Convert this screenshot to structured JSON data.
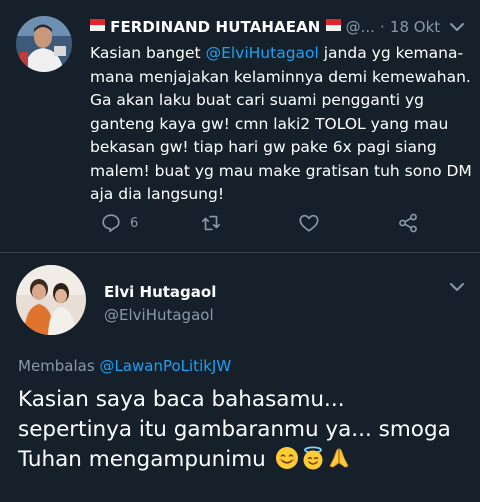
{
  "tweet": {
    "author_name": "FERDINAND HUTAHAEAN",
    "handle_truncated": "@...",
    "dot": "·",
    "time": "18 Okt",
    "text_before_mention": "Kasian banget ",
    "mention": "@ElviHutagaol",
    "text_after_mention": " janda yg kemana-\nmana menjajakan kelaminnya demi kemewahan.\nGa akan laku buat cari suami pengganti yg\nganteng kaya gw! cmn laki2 TOLOL yang mau\nbekasan gw! tiap hari gw pake 6x pagi siang\nmalem! buat yg mau make gratisan tuh sono DM\naja dia langsung!",
    "reply_count": "6",
    "icons": [
      "reply-icon",
      "retweet-icon",
      "like-icon",
      "share-icon"
    ],
    "flag_colors": {
      "red": "#e0262b",
      "white": "#f2f2f2"
    }
  },
  "reply_tweet": {
    "author_name": "Elvi Hutagaol",
    "handle": "@ElviHutagaol",
    "replying_prefix": "Membalas ",
    "replying_to": "@LawanPoLitikJW",
    "lines": [
      "Kasian saya baca bahasamu...",
      "sepertinya itu gambaranmu ya... smoga",
      "Tuhan mengampunimu"
    ],
    "emojis": [
      "smiling-face-emoji",
      "halo-face-emoji",
      "praying-hands-emoji"
    ]
  },
  "colors": {
    "background": "#15202b",
    "link": "#1da1f2",
    "secondary_text": "#8899a6",
    "separator": "#38444d"
  }
}
